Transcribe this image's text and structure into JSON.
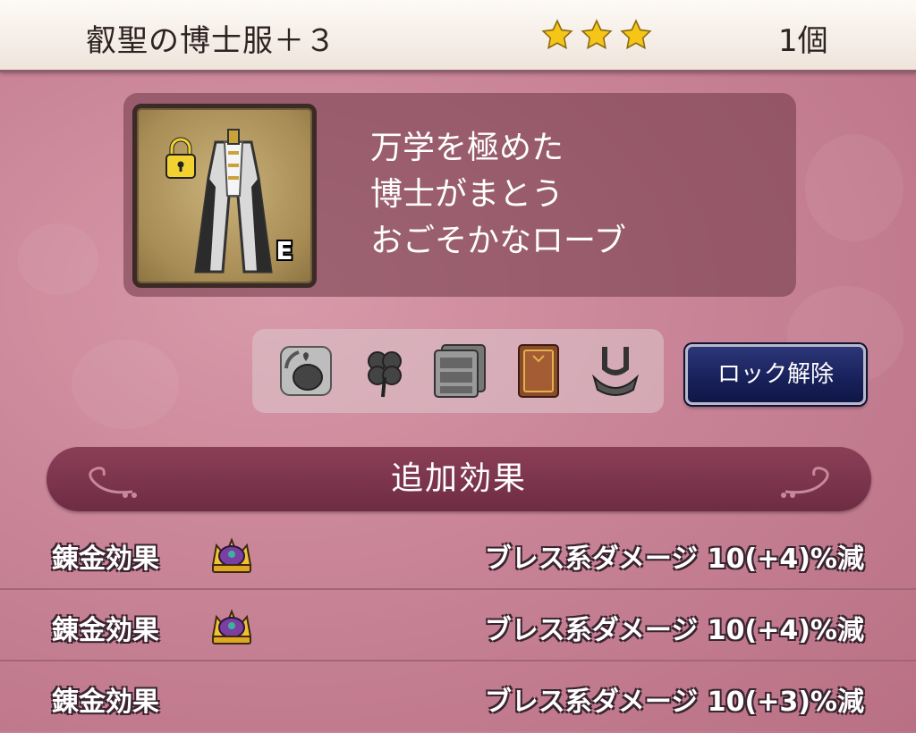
{
  "header": {
    "item_name": "叡聖の博士服＋３",
    "rarity_stars": 3,
    "count": "1個"
  },
  "item": {
    "equipped_badge": "E",
    "locked": true,
    "description": [
      "万学を極めた",
      "博士がまとう",
      "おごそかなローブ"
    ]
  },
  "tray_icons": [
    "reroll-bag-icon",
    "clover-icon",
    "storage-drawers-icon",
    "book-icon",
    "fork-tool-icon"
  ],
  "unlock_button": {
    "label": "ロック解除"
  },
  "section": {
    "title": "追加効果"
  },
  "effects": [
    {
      "label": "錬金効果",
      "has_crown": true,
      "value": "ブレス系ダメージ  10(+4)%減"
    },
    {
      "label": "錬金効果",
      "has_crown": true,
      "value": "ブレス系ダメージ  10(+4)%減"
    },
    {
      "label": "錬金効果",
      "has_crown": false,
      "value": "ブレス系ダメージ  10(+3)%減"
    }
  ],
  "colors": {
    "background": "#c98497",
    "section_bar": "#7a334b",
    "button": "#1c2462",
    "star": "#f5c518"
  }
}
